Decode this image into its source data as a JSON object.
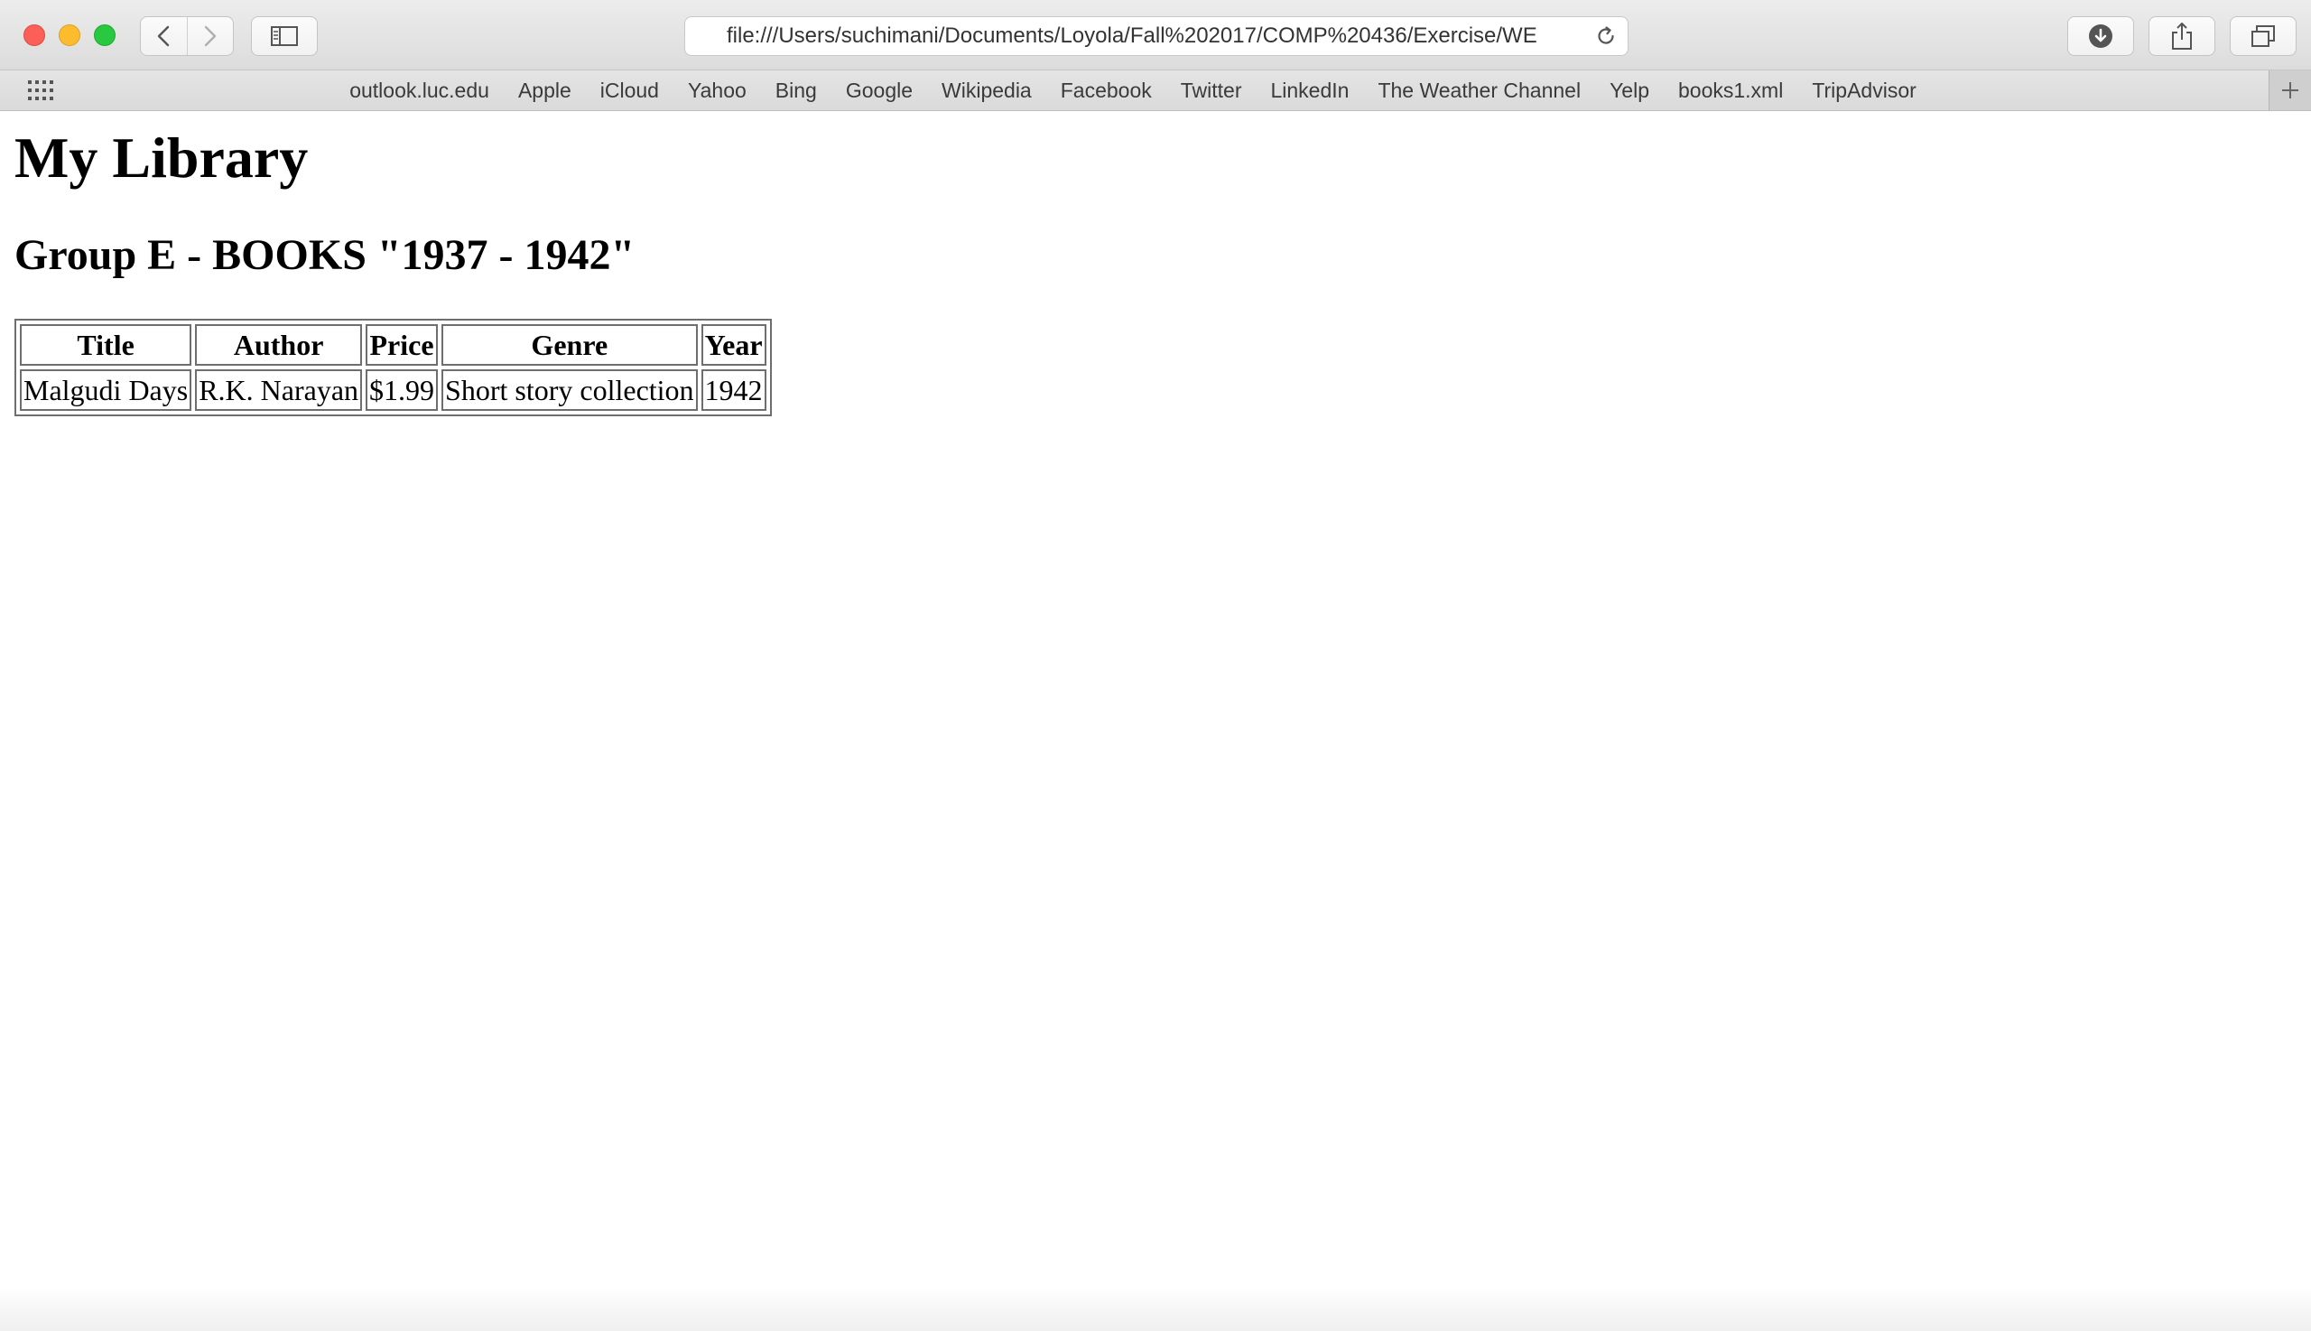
{
  "browser": {
    "address_url": "file:///Users/suchimani/Documents/Loyola/Fall%202017/COMP%20436/Exercise/WE",
    "icons": {
      "back": "chevron-left-icon",
      "forward": "chevron-right-icon",
      "sidebar": "sidebar-icon",
      "reload": "reload-icon",
      "download": "download-icon",
      "share": "share-icon",
      "tabs": "tabs-overview-icon",
      "favorites_grid": "grid-icon",
      "add": "plus-icon"
    },
    "colors": {
      "close": "#fc5f57",
      "minimize": "#fdbc2e",
      "maximize": "#28c840"
    }
  },
  "favorites": [
    {
      "label": "outlook.luc.edu"
    },
    {
      "label": "Apple"
    },
    {
      "label": "iCloud"
    },
    {
      "label": "Yahoo"
    },
    {
      "label": "Bing"
    },
    {
      "label": "Google"
    },
    {
      "label": "Wikipedia"
    },
    {
      "label": "Facebook"
    },
    {
      "label": "Twitter"
    },
    {
      "label": "LinkedIn"
    },
    {
      "label": "The Weather Channel"
    },
    {
      "label": "Yelp"
    },
    {
      "label": "books1.xml"
    },
    {
      "label": "TripAdvisor"
    }
  ],
  "page": {
    "title": "My Library",
    "subtitle": "Group E - BOOKS \"1937 - 1942\"",
    "table": {
      "headers": [
        "Title",
        "Author",
        "Price",
        "Genre",
        "Year"
      ],
      "rows": [
        [
          "Malgudi Days",
          "R.K. Narayan",
          "$1.99",
          "Short story collection",
          "1942"
        ]
      ]
    }
  }
}
